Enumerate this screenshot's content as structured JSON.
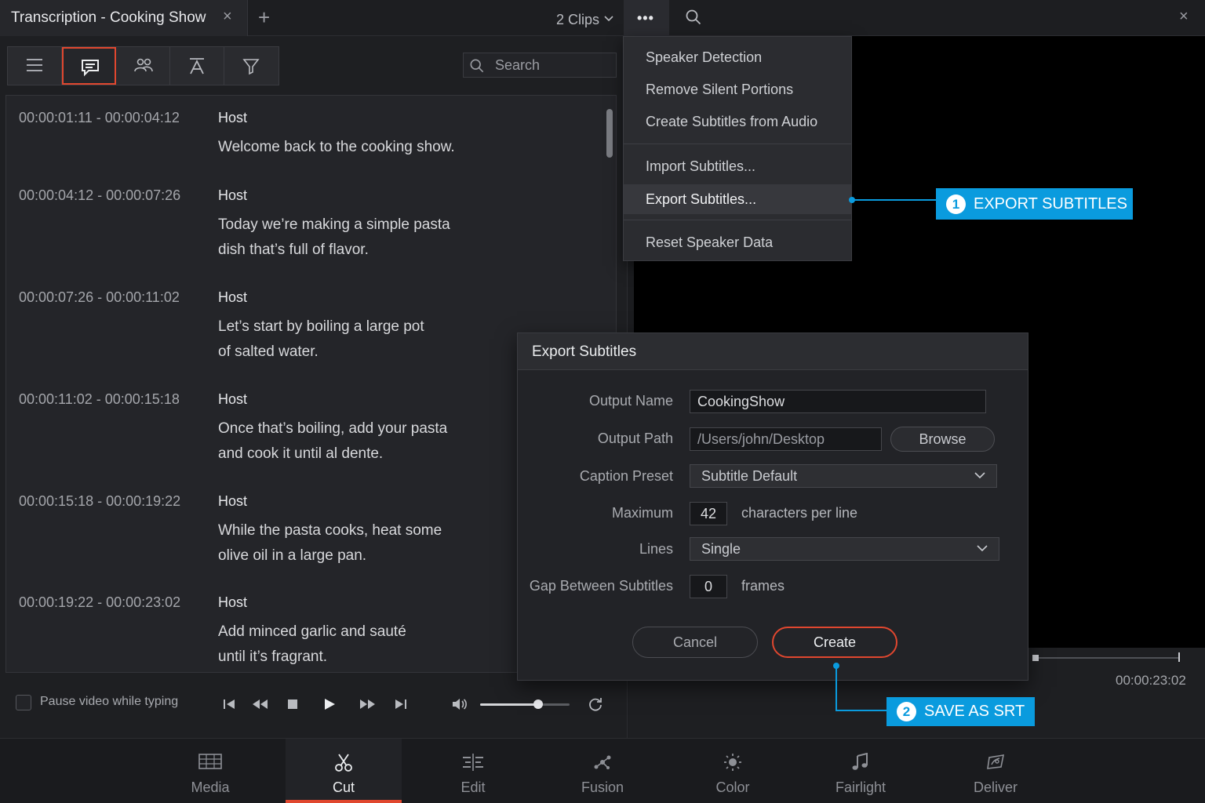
{
  "tabbar": {
    "title": "Transcription - Cooking Show",
    "close_glyph": "×",
    "add_glyph": "+",
    "clips_label": "2 Clips",
    "more_glyph": "•••",
    "close_window_glyph": "×"
  },
  "toolbar": {
    "buttons": [
      "list-icon",
      "subtitles-icon",
      "speakers-icon",
      "text-style-icon",
      "filter-icon"
    ],
    "active": "subtitles-icon",
    "search_placeholder": "Search"
  },
  "transcript": [
    {
      "time": "00:00:01:11 - 00:00:04:12",
      "speaker": "Host",
      "lines": [
        "Welcome back to the cooking show."
      ]
    },
    {
      "time": "00:00:04:12 - 00:00:07:26",
      "speaker": "Host",
      "lines": [
        "Today we’re making a simple pasta",
        "dish that’s full of flavor."
      ]
    },
    {
      "time": "00:00:07:26 - 00:00:11:02",
      "speaker": "Host",
      "lines": [
        "Let’s start by boiling a large pot",
        "of salted water."
      ]
    },
    {
      "time": "00:00:11:02 - 00:00:15:18",
      "speaker": "Host",
      "lines": [
        "Once that’s boiling, add your pasta",
        "and cook it until al dente."
      ]
    },
    {
      "time": "00:00:15:18 - 00:00:19:22",
      "speaker": "Host",
      "lines": [
        "While the pasta cooks, heat some",
        "olive oil in a large pan."
      ]
    },
    {
      "time": "00:00:19:22 - 00:00:23:02",
      "speaker": "Host",
      "lines": [
        "Add minced garlic and sauté",
        "until it’s fragrant."
      ]
    }
  ],
  "playback": {
    "pause_label": "Pause video while typing",
    "pause_checked": false,
    "volume_fraction": 0.65,
    "timecode": "00:00:23:02"
  },
  "menu": {
    "items": [
      "Speaker Detection",
      "Remove Silent Portions",
      "Create Subtitles from Audio",
      "Import Subtitles...",
      "Export Subtitles...",
      "Reset Speaker Data"
    ],
    "highlighted": "Export Subtitles..."
  },
  "dialog": {
    "title": "Export Subtitles",
    "output_name_label": "Output Name",
    "output_name_value": "CookingShow",
    "output_path_label": "Output Path",
    "output_path_value": "/Users/john/Desktop",
    "browse_label": "Browse",
    "caption_preset_label": "Caption Preset",
    "caption_preset_value": "Subtitle Default",
    "maximum_label": "Maximum",
    "maximum_value": "42",
    "maximum_suffix": "characters per line",
    "lines_label": "Lines",
    "lines_value": "Single",
    "gap_label": "Gap Between Subtitles",
    "gap_value": "0",
    "gap_suffix": "frames",
    "cancel_label": "Cancel",
    "create_label": "Create"
  },
  "callouts": [
    {
      "number": "1",
      "label": "EXPORT SUBTITLES"
    },
    {
      "number": "2",
      "label": "SAVE AS SRT"
    }
  ],
  "colors": {
    "accent_red": "#e0472f",
    "callout_blue": "#0a9bde"
  },
  "pages": [
    {
      "label": "Media",
      "icon": "media-icon"
    },
    {
      "label": "Cut",
      "icon": "scissors-icon",
      "active": true
    },
    {
      "label": "Edit",
      "icon": "edit-icon"
    },
    {
      "label": "Fusion",
      "icon": "fusion-icon"
    },
    {
      "label": "Color",
      "icon": "color-icon"
    },
    {
      "label": "Fairlight",
      "icon": "music-note-icon"
    },
    {
      "label": "Deliver",
      "icon": "rocket-icon"
    }
  ]
}
